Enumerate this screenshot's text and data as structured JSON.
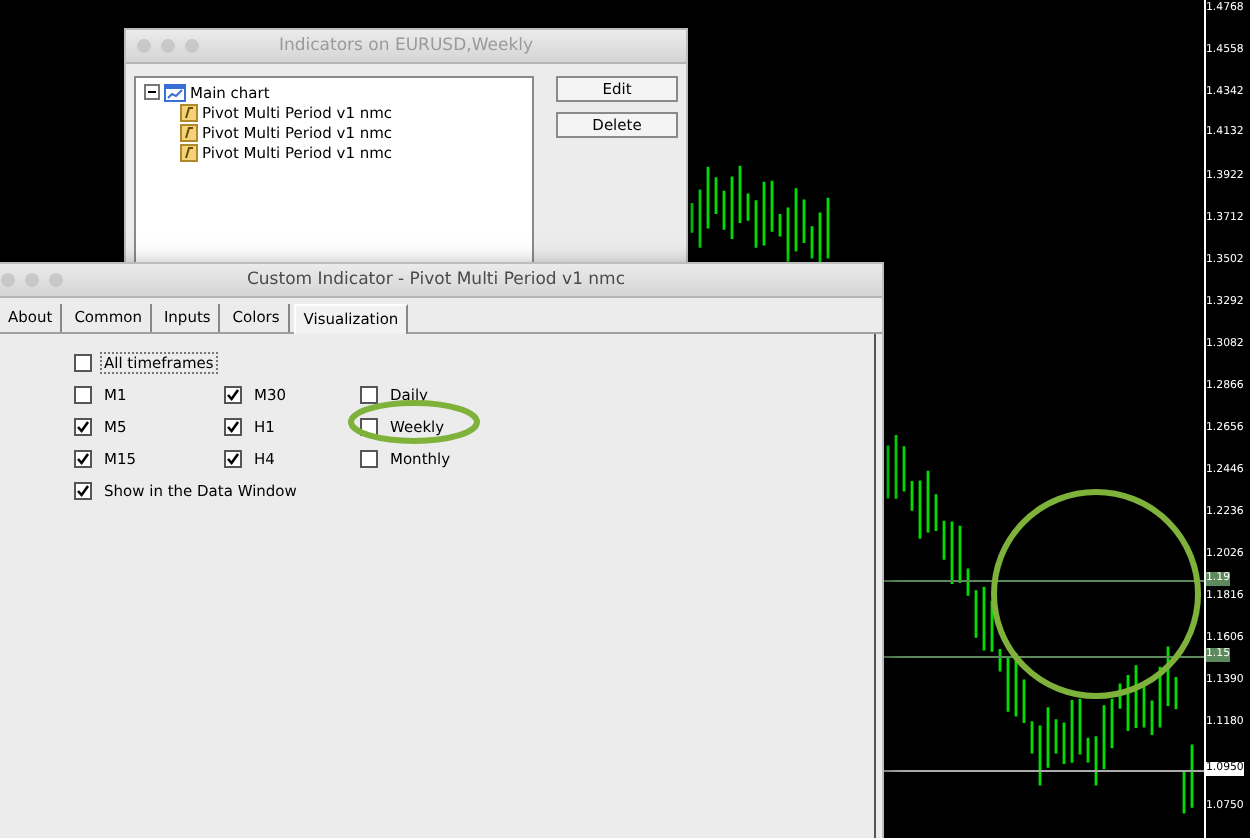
{
  "chart": {
    "price_labels": [
      {
        "text": "1.4768",
        "kind": "plain"
      },
      {
        "text": "1.4558",
        "kind": "plain"
      },
      {
        "text": "1.4342",
        "kind": "plain"
      },
      {
        "text": "1.4132",
        "kind": "plain"
      },
      {
        "text": "1.3922",
        "kind": "plain"
      },
      {
        "text": "1.3712",
        "kind": "plain"
      },
      {
        "text": "1.3502",
        "kind": "plain"
      },
      {
        "text": "1.3292",
        "kind": "plain"
      },
      {
        "text": "1.3082",
        "kind": "plain"
      },
      {
        "text": "1.2866",
        "kind": "plain"
      },
      {
        "text": "1.2656",
        "kind": "plain"
      },
      {
        "text": "1.2446",
        "kind": "plain"
      },
      {
        "text": "1.2236",
        "kind": "plain"
      },
      {
        "text": "1.2026",
        "kind": "plain"
      },
      {
        "text": "1.19",
        "kind": "line"
      },
      {
        "text": "1.1816",
        "kind": "plain"
      },
      {
        "text": "1.1606",
        "kind": "plain"
      },
      {
        "text": "1.15",
        "kind": "line"
      },
      {
        "text": "1.1390",
        "kind": "plain"
      },
      {
        "text": "1.1180",
        "kind": "plain"
      },
      {
        "text": "1.0950",
        "kind": "current"
      },
      {
        "text": "1.0750",
        "kind": "plain"
      }
    ]
  },
  "indicators_window": {
    "title": "Indicators on EURUSD,Weekly",
    "tree": [
      {
        "label": "Main chart",
        "expanded": true,
        "children": [
          {
            "label": "Pivot Multi Period v1 nmc"
          },
          {
            "label": "Pivot Multi Period v1 nmc"
          },
          {
            "label": "Pivot Multi Period v1 nmc"
          }
        ]
      }
    ],
    "buttons": [
      "Edit",
      "Delete"
    ]
  },
  "custom_indicator_window": {
    "title": "Custom Indicator - Pivot Multi Period v1 nmc",
    "tabs": [
      {
        "label": "About",
        "selected": false
      },
      {
        "label": "Common",
        "selected": false
      },
      {
        "label": "Inputs",
        "selected": false
      },
      {
        "label": "Colors",
        "selected": false
      },
      {
        "label": "Visualization",
        "selected": true
      }
    ],
    "all_timeframes": {
      "label": "All timeframes",
      "checked": false
    },
    "timeframes": [
      {
        "label": "M1",
        "checked": false
      },
      {
        "label": "M5",
        "checked": true
      },
      {
        "label": "M15",
        "checked": true
      },
      {
        "label": "M30",
        "checked": true
      },
      {
        "label": "H1",
        "checked": true
      },
      {
        "label": "H4",
        "checked": true
      },
      {
        "label": "Daily",
        "checked": false
      },
      {
        "label": "Weekly",
        "checked": false
      },
      {
        "label": "Monthly",
        "checked": false
      }
    ],
    "show_in_data_window": {
      "label": "Show in the Data Window",
      "checked": true
    }
  }
}
